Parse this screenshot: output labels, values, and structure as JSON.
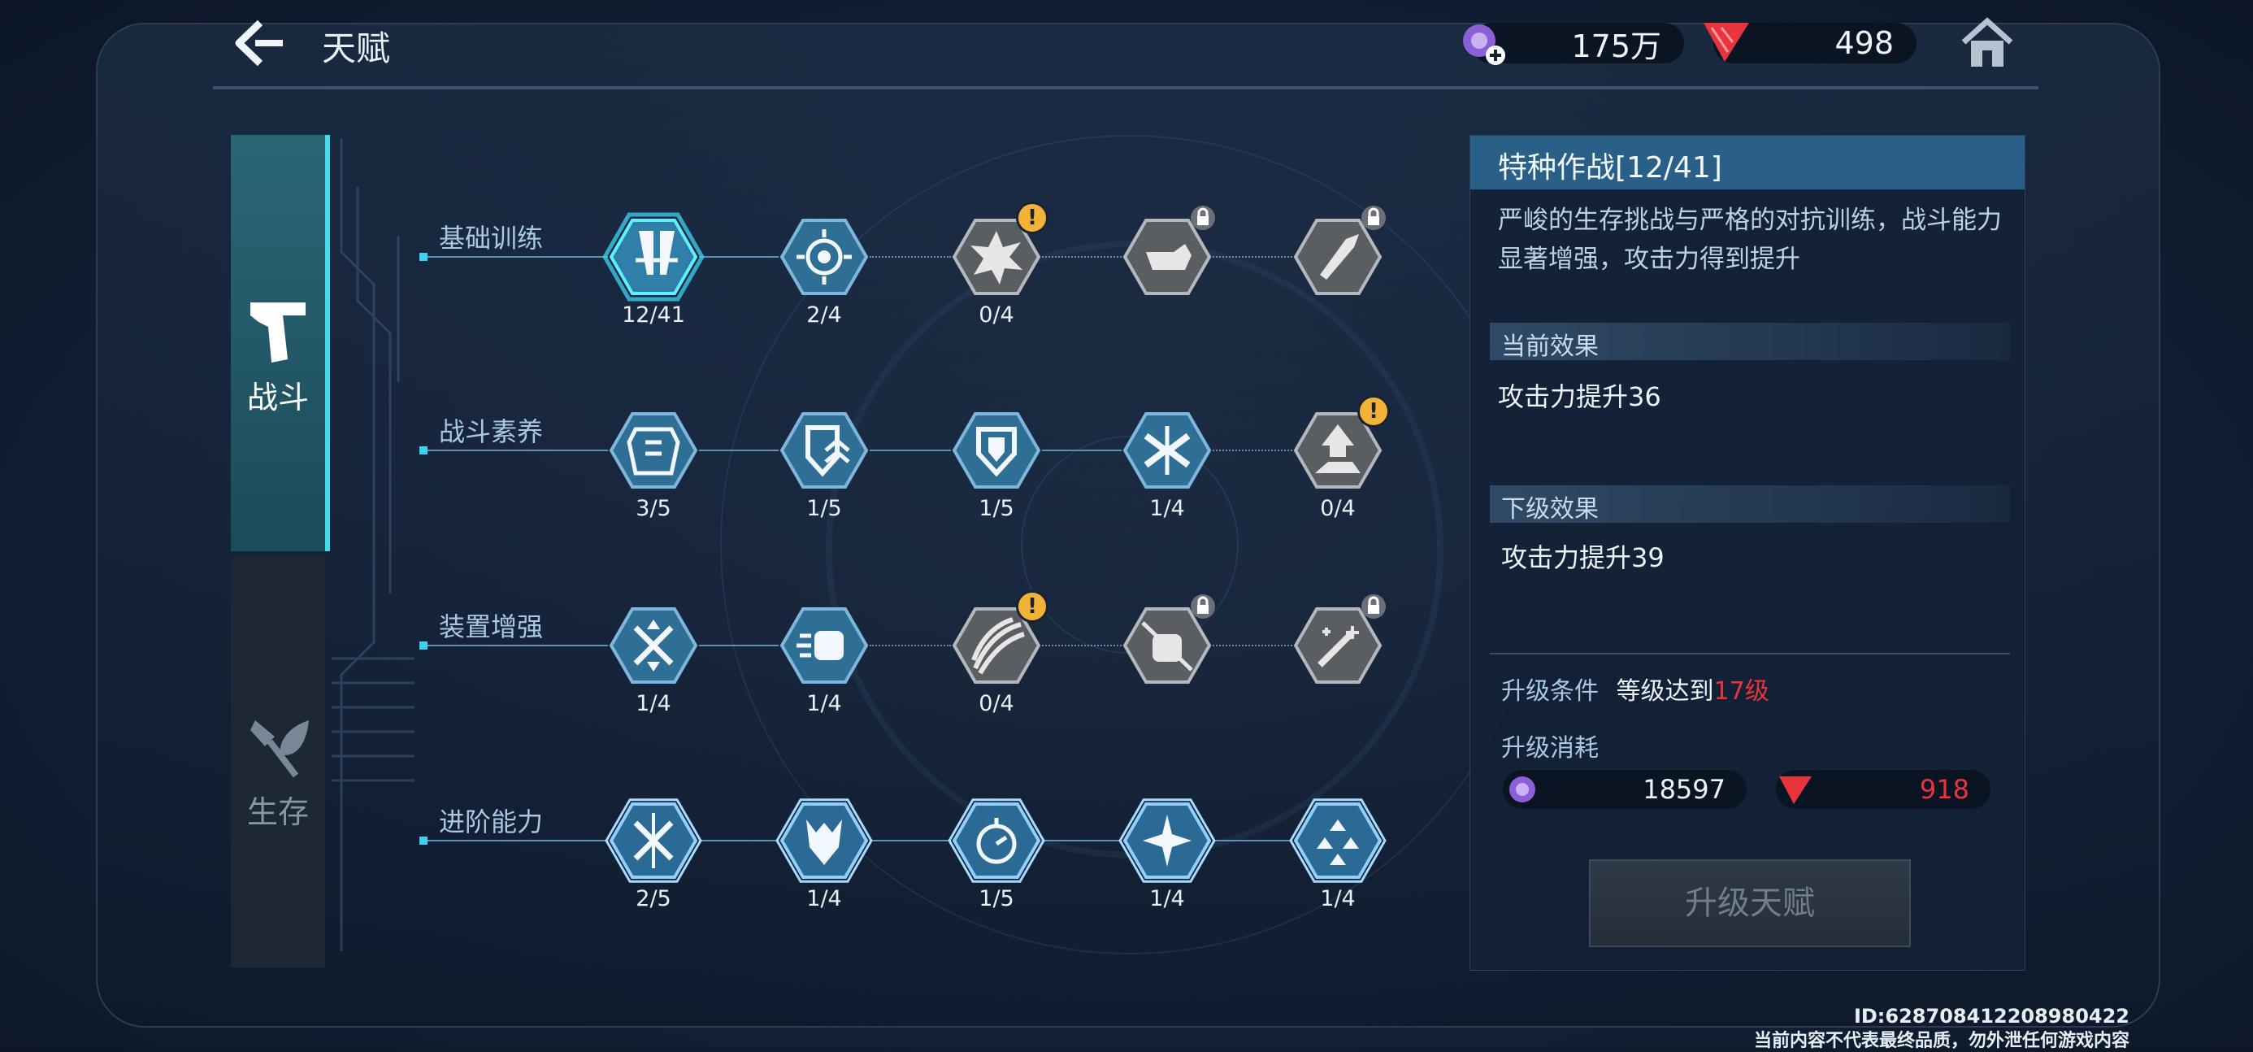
{
  "header": {
    "title": "天赋",
    "currency_crystal": "175万",
    "currency_red": "498"
  },
  "tabs": [
    {
      "label": "战斗",
      "icon": "pistol-icon",
      "active": true
    },
    {
      "label": "生存",
      "icon": "leaf-axe-icon",
      "active": false
    }
  ],
  "rows": [
    {
      "label": "基础训练",
      "nodes": [
        {
          "count": "12/41",
          "icon": "blades-icon",
          "state": "selected"
        },
        {
          "count": "2/4",
          "icon": "target-spiral-icon",
          "state": "active"
        },
        {
          "count": "0/4",
          "icon": "explosion-icon",
          "state": "available-alert"
        },
        {
          "count": "",
          "icon": "fist-punch-icon",
          "state": "locked"
        },
        {
          "count": "",
          "icon": "rocket-shield-icon",
          "state": "locked"
        }
      ]
    },
    {
      "label": "战斗素养",
      "nodes": [
        {
          "count": "3/5",
          "icon": "armor-vest-icon",
          "state": "active"
        },
        {
          "count": "1/5",
          "icon": "shield-chevron-icon",
          "state": "active"
        },
        {
          "count": "1/5",
          "icon": "shield-double-icon",
          "state": "active"
        },
        {
          "count": "1/4",
          "icon": "arrows-cross-icon",
          "state": "active"
        },
        {
          "count": "0/4",
          "icon": "boot-kick-icon",
          "state": "available-alert"
        }
      ]
    },
    {
      "label": "装置增强",
      "nodes": [
        {
          "count": "1/4",
          "icon": "arrows-scatter-icon",
          "state": "active"
        },
        {
          "count": "1/4",
          "icon": "fist-speed-icon",
          "state": "active"
        },
        {
          "count": "0/4",
          "icon": "claw-slash-icon",
          "state": "available-alert"
        },
        {
          "count": "",
          "icon": "fist-sword-icon",
          "state": "locked"
        },
        {
          "count": "",
          "icon": "syringe-sparks-icon",
          "state": "locked"
        }
      ]
    },
    {
      "label": "进阶能力",
      "nodes": [
        {
          "count": "2/5",
          "icon": "crossed-lines-icon",
          "state": "advanced"
        },
        {
          "count": "1/4",
          "icon": "beast-head-icon",
          "state": "advanced"
        },
        {
          "count": "1/5",
          "icon": "stopwatch-icon",
          "state": "advanced"
        },
        {
          "count": "1/4",
          "icon": "star-burst-icon",
          "state": "advanced"
        },
        {
          "count": "1/4",
          "icon": "hex-cluster-icon",
          "state": "advanced"
        }
      ]
    }
  ],
  "panel": {
    "title": "特种作战[12/41]",
    "description": "严峻的生存挑战与严格的对抗训练，战斗能力显著增强，攻击力得到提升",
    "current_label": "当前效果",
    "current_value": "攻击力提升36",
    "next_label": "下级效果",
    "next_value": "攻击力提升39",
    "cond_label": "升级条件",
    "cond_text": "等级达到",
    "cond_level": "17级",
    "cost_label": "升级消耗",
    "cost_crystal": "18597",
    "cost_red": "918",
    "upgrade_button": "升级天赋"
  },
  "footer": {
    "id_text": "ID:628708412208980422",
    "notice": "当前内容不代表最终品质，勿外泄任何游戏内容"
  },
  "colors": {
    "accent": "#45d9ec",
    "alert": "#f1b238",
    "red": "#e8343c",
    "crystal": "#8b5fd6"
  }
}
